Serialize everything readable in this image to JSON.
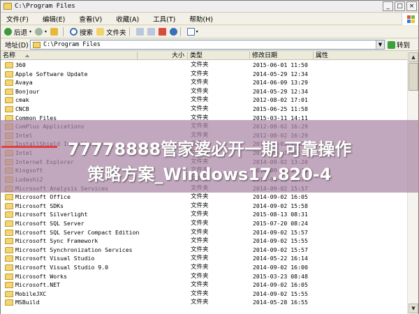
{
  "window": {
    "title": "C:\\Program Files",
    "controls": [
      "_",
      "□",
      "×"
    ]
  },
  "menu": [
    "文件(F)",
    "编辑(E)",
    "查看(V)",
    "收藏(A)",
    "工具(T)",
    "帮助(H)"
  ],
  "toolbar": {
    "back_label": "后退",
    "search_label": "搜索",
    "folders_label": "文件夹"
  },
  "address": {
    "label": "地址(D)",
    "value": "C:\\Program Files",
    "go_label": "转到"
  },
  "columns": {
    "name": "名称",
    "size": "大小",
    "type": "类型",
    "modified": "修改日期",
    "attributes": "属性"
  },
  "rows": [
    {
      "name": "360",
      "type": "文件夹",
      "date": "2015-06-01 11:50"
    },
    {
      "name": "Apple Software Update",
      "type": "文件夹",
      "date": "2014-05-29 12:34"
    },
    {
      "name": "Avaya",
      "type": "文件夹",
      "date": "2014-06-09 13:29"
    },
    {
      "name": "Bonjour",
      "type": "文件夹",
      "date": "2014-05-29 12:34"
    },
    {
      "name": "cmak",
      "type": "文件夹",
      "date": "2012-08-02 17:01"
    },
    {
      "name": "CNCB",
      "type": "文件夹",
      "date": "2015-06-25 11:58"
    },
    {
      "name": "Common Files",
      "type": "文件夹",
      "date": "2015-03-11 14:11"
    },
    {
      "name": "ComPlus Applications",
      "type": "文件夹",
      "date": "2012-08-02 16:29"
    },
    {
      "name": "Intel",
      "type": "文件夹",
      "date": "2012-08-02 16:29"
    },
    {
      "name": "InstallShield Installation",
      "type": "文件夹",
      "date": "2014-09-02 15:29"
    },
    {
      "name": "Intel",
      "type": "文件夹",
      "date": "2013-05-17 10:29"
    },
    {
      "name": "Internet Explorer",
      "type": "文件夹",
      "date": "2014-09-02 13:20"
    },
    {
      "name": "Kingsoft",
      "type": "文件夹",
      "date": "2014-09-02 15:10"
    },
    {
      "name": "Ludashi2",
      "type": "文件夹",
      "date": "2014-06-09 13:29"
    },
    {
      "name": "Microsoft Analysis Services",
      "type": "文件夹",
      "date": "2014-09-02 15:57"
    },
    {
      "name": "Microsoft Office",
      "type": "文件夹",
      "date": "2014-09-02 16:05"
    },
    {
      "name": "Microsoft SDKs",
      "type": "文件夹",
      "date": "2014-09-02 15:58"
    },
    {
      "name": "Microsoft Silverlight",
      "type": "文件夹",
      "date": "2015-08-13 08:31"
    },
    {
      "name": "Microsoft SQL Server",
      "type": "文件夹",
      "date": "2015-07-20 08:24"
    },
    {
      "name": "Microsoft SQL Server Compact Edition",
      "type": "文件夹",
      "date": "2014-09-02 15:57"
    },
    {
      "name": "Microsoft Sync Framework",
      "type": "文件夹",
      "date": "2014-09-02 15:55"
    },
    {
      "name": "Microsoft Synchronization Services",
      "type": "文件夹",
      "date": "2014-09-02 15:57"
    },
    {
      "name": "Microsoft Visual Studio",
      "type": "文件夹",
      "date": "2014-05-22 16:14"
    },
    {
      "name": "Microsoft Visual Studio 9.0",
      "type": "文件夹",
      "date": "2014-09-02 16:00"
    },
    {
      "name": "Microsoft Works",
      "type": "文件夹",
      "date": "2015-03-23 08:48"
    },
    {
      "name": "Microsoft.NET",
      "type": "文件夹",
      "date": "2014-09-02 16:05"
    },
    {
      "name": "MobileJXC",
      "type": "文件夹",
      "date": "2014-09-02 15:55"
    },
    {
      "name": "MSBuild",
      "type": "文件夹",
      "date": "2014-05-28 16:55"
    }
  ],
  "overlay": {
    "line1": "77778888管家婆必开一期,可靠操作",
    "line2": "策略方案_Windows17.820-4"
  },
  "colors": {
    "folder": "#f3d671",
    "overlay": "#aa87a5",
    "header": "#ebeadb"
  }
}
